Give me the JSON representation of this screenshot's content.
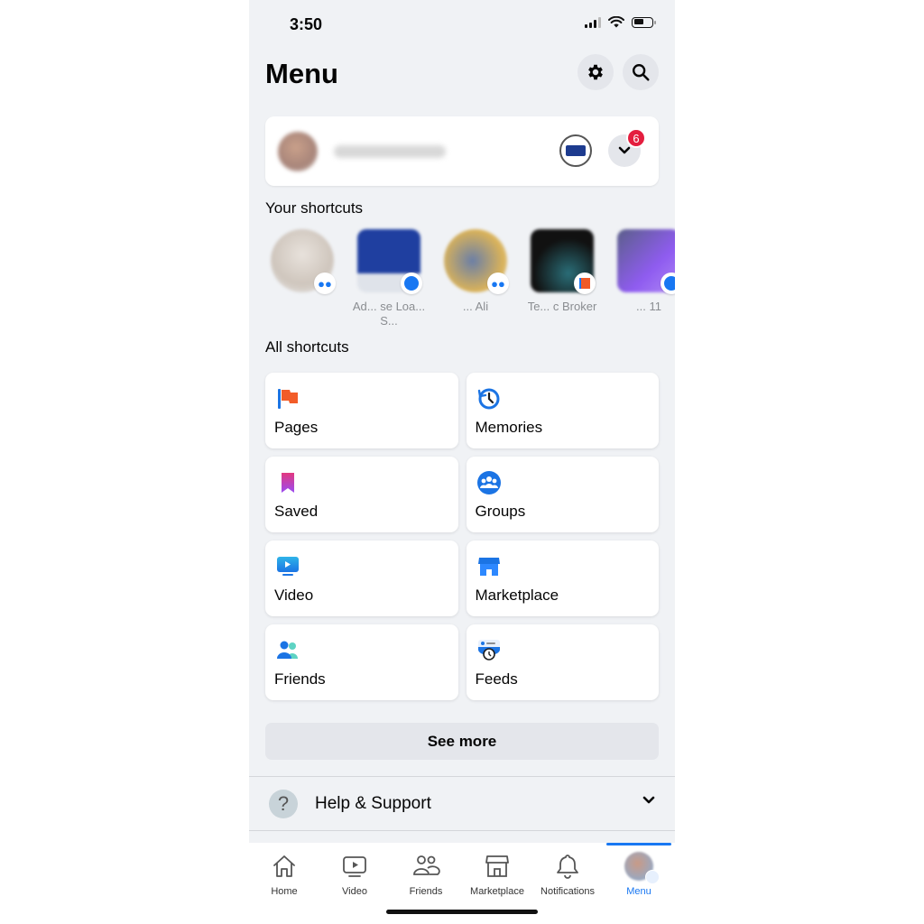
{
  "status_bar": {
    "time": "3:50"
  },
  "header": {
    "title": "Menu",
    "settings_icon": "gear-icon",
    "search_icon": "search-icon"
  },
  "profile": {
    "name": "(blurred)",
    "notification_count": "6"
  },
  "your_shortcuts": {
    "title": "Your shortcuts",
    "items": [
      {
        "label": "",
        "type": "friend",
        "badge_icon": "friends-icon"
      },
      {
        "label": "Ad... se Loa... S...",
        "type": "group",
        "badge_icon": "groups-icon"
      },
      {
        "label": "... Ali",
        "type": "friend",
        "badge_icon": "friends-icon"
      },
      {
        "label": "Te... c Broker",
        "type": "page",
        "badge_icon": "flag-icon"
      },
      {
        "label": "... 11",
        "type": "group",
        "badge_icon": "groups-icon"
      }
    ]
  },
  "all_shortcuts": {
    "title": "All shortcuts",
    "items": [
      {
        "label": "Pages",
        "icon": "pages-flag-icon"
      },
      {
        "label": "Memories",
        "icon": "memories-clock-icon"
      },
      {
        "label": "Saved",
        "icon": "saved-bookmark-icon"
      },
      {
        "label": "Groups",
        "icon": "groups-icon"
      },
      {
        "label": "Video",
        "icon": "video-icon"
      },
      {
        "label": "Marketplace",
        "icon": "marketplace-store-icon"
      },
      {
        "label": "Friends",
        "icon": "friends-icon"
      },
      {
        "label": "Feeds",
        "icon": "feeds-icon"
      }
    ]
  },
  "see_more": "See more",
  "help": {
    "label": "Help & Support"
  },
  "tabbar": {
    "items": [
      {
        "label": "Home",
        "active": false
      },
      {
        "label": "Video",
        "active": false
      },
      {
        "label": "Friends",
        "active": false
      },
      {
        "label": "Marketplace",
        "active": false
      },
      {
        "label": "Notifications",
        "active": false
      },
      {
        "label": "Menu",
        "active": true
      }
    ]
  },
  "colors": {
    "accent": "#1877f2",
    "badge": "#e41e3f",
    "background": "#f0f2f5"
  }
}
